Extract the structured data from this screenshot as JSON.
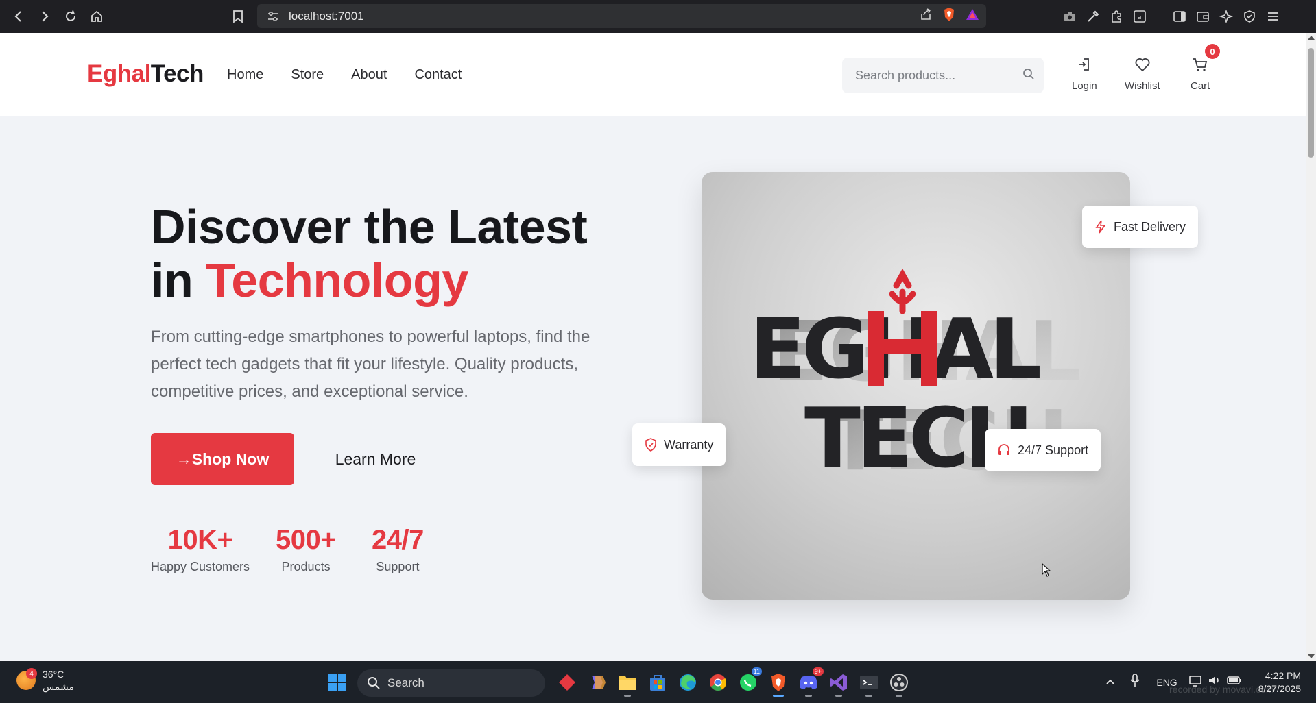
{
  "browser": {
    "url": "localhost:7001"
  },
  "header": {
    "logo_part1": "Eghal",
    "logo_part2": "Tech",
    "nav": [
      "Home",
      "Store",
      "About",
      "Contact"
    ],
    "search_placeholder": "Search products...",
    "login_label": "Login",
    "wishlist_label": "Wishlist",
    "cart_label": "Cart",
    "cart_count": "0"
  },
  "hero": {
    "title_line1": "Discover the Latest",
    "title_line2_prefix": "in ",
    "title_line2_accent": "Technology",
    "description": "From cutting-edge smartphones to powerful laptops, find the perfect tech gadgets that fit your lifestyle. Quality products, competitive prices, and exceptional service.",
    "shop_button": "→Shop Now",
    "learn_button": "Learn More",
    "stats": [
      {
        "value": "10K+",
        "label": "Happy Customers"
      },
      {
        "value": "500+",
        "label": "Products"
      },
      {
        "value": "24/7",
        "label": "Support"
      }
    ],
    "badges": {
      "fast_delivery": "Fast Delivery",
      "warranty": "Warranty",
      "support": "24/7 Support"
    },
    "image_logo_line1": "EGHAL",
    "image_logo_line2": "TECH"
  },
  "taskbar": {
    "weather_temp": "36°C",
    "weather_desc": "مشمس",
    "weather_badge": "4",
    "search_label": "Search",
    "language": "ENG",
    "time": "4:22 PM",
    "date": "8/27/2025",
    "whatsapp_badge": "11",
    "discord_badge": "9+"
  },
  "watermark": "recorded by movavi.com",
  "colors": {
    "accent": "#e53941",
    "dark": "#17181c"
  }
}
